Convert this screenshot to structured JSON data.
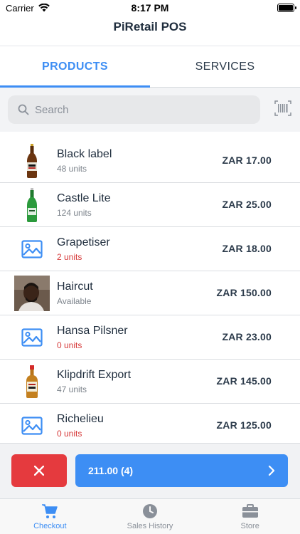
{
  "status_bar": {
    "carrier": "Carrier",
    "time": "8:17 PM"
  },
  "nav": {
    "title": "PiRetail POS"
  },
  "tabs": [
    {
      "label": "PRODUCTS",
      "active": true
    },
    {
      "label": "SERVICES",
      "active": false
    }
  ],
  "search": {
    "placeholder": "Search"
  },
  "products": [
    {
      "name": "Black label",
      "units": "48 units",
      "price": "ZAR 17.00",
      "out": false,
      "image": "beer-bottle-brown"
    },
    {
      "name": "Castle Lite",
      "units": "124 units",
      "price": "ZAR 25.00",
      "out": false,
      "image": "beer-bottle-green"
    },
    {
      "name": "Grapetiser",
      "units": "2 units",
      "price": "ZAR 18.00",
      "out": true,
      "image": "image-placeholder"
    },
    {
      "name": "Haircut",
      "units": "Available",
      "price": "ZAR 150.00",
      "out": false,
      "image": "haircut-photo"
    },
    {
      "name": "Hansa Pilsner",
      "units": "0 units",
      "price": "ZAR 23.00",
      "out": true,
      "image": "image-placeholder"
    },
    {
      "name": "Klipdrift Export",
      "units": "47 units",
      "price": "ZAR 145.00",
      "out": false,
      "image": "liquor-bottle"
    },
    {
      "name": "Richelieu",
      "units": "0 units",
      "price": "ZAR 125.00",
      "out": true,
      "image": "image-placeholder"
    }
  ],
  "actions": {
    "checkout_label": "211.00 (4)"
  },
  "tabbar": [
    {
      "label": "Checkout",
      "icon": "cart-icon",
      "active": true
    },
    {
      "label": "Sales History",
      "icon": "clock-icon",
      "active": false
    },
    {
      "label": "Store",
      "icon": "briefcase-icon",
      "active": false
    }
  ],
  "colors": {
    "accent": "#3d8ef4",
    "danger": "#e53a3e",
    "out_of_stock": "#d63a3a"
  }
}
